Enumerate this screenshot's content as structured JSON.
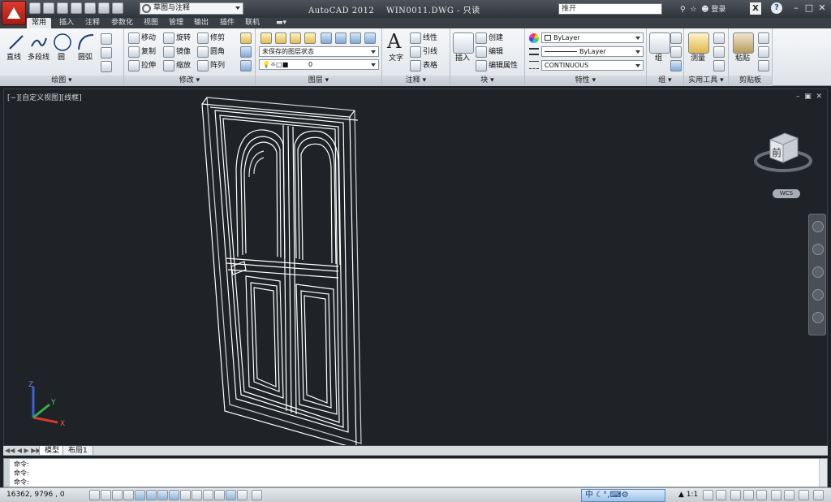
{
  "titlebar": {
    "app_title": "AutoCAD 2012",
    "file_name": "WIN0011.DWG",
    "title_suffix": "- 只读",
    "workspace": "草图与注释",
    "search_text": "推开",
    "login_label": "登录"
  },
  "tabs": [
    "常用",
    "插入",
    "注释",
    "参数化",
    "视图",
    "管理",
    "输出",
    "插件",
    "联机"
  ],
  "ribbon": {
    "draw": {
      "title": "绘图",
      "tools": [
        "直线",
        "多段线",
        "圆",
        "圆弧"
      ]
    },
    "modify": {
      "title": "修改",
      "tools": [
        "移动",
        "旋转",
        "修剪",
        "复制",
        "镜像",
        "圆角",
        "拉伸",
        "缩放",
        "阵列"
      ]
    },
    "layers": {
      "title": "图层",
      "layer_state": "未保存的图层状态",
      "current_layer": "0"
    },
    "annotation": {
      "title": "注释",
      "text_label": "文字",
      "tools": [
        "线性",
        "引线",
        "表格"
      ]
    },
    "block": {
      "title": "块",
      "insert_label": "插入",
      "tools": [
        "创建",
        "编辑",
        "编辑属性"
      ]
    },
    "properties": {
      "title": "特性",
      "color": "ByLayer",
      "lineweight": "ByLayer",
      "linetype": "CONTINUOUS"
    },
    "groups": {
      "title": "组",
      "group_label": "组"
    },
    "utilities": {
      "title": "实用工具",
      "measure_label": "测量"
    },
    "clipboard": {
      "title": "剪贴板",
      "paste_label": "粘贴"
    }
  },
  "viewport": {
    "label": "[−][自定义视图][线框]",
    "viewcube_face": "前",
    "wcs_label": "WCS",
    "ucs_axes": [
      "X",
      "Y",
      "Z"
    ]
  },
  "layout_tabs": [
    "模型",
    "布局1"
  ],
  "command_line": [
    "命令:",
    "命令:",
    "命令:"
  ],
  "status": {
    "coordinates": "16362, 9796 , 0",
    "ime_label": "中",
    "annotation_scale": "1:1"
  },
  "colors": {
    "titlebar": "#2f343a",
    "drawing_bg": "#1f2226",
    "app_button": "#c8261b",
    "wireframe": "#ffffff"
  }
}
